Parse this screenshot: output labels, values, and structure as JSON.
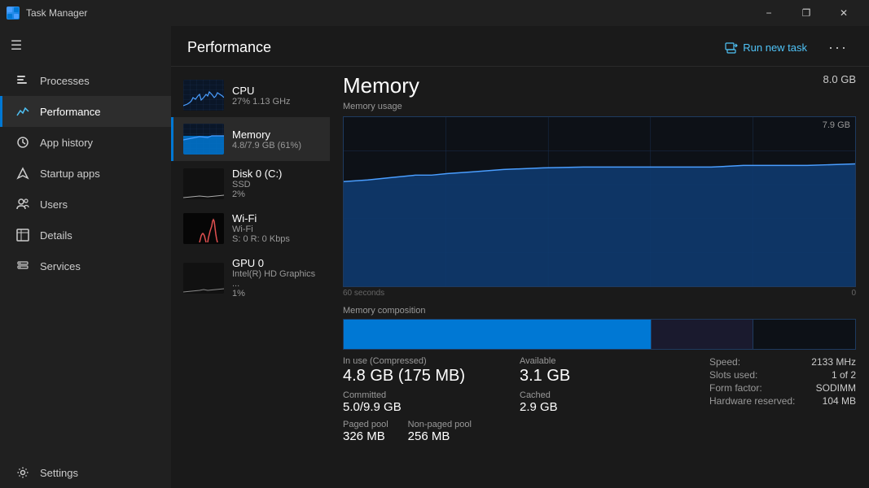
{
  "titlebar": {
    "icon_label": "task-manager-icon",
    "title": "Task Manager",
    "minimize_label": "−",
    "restore_label": "❐",
    "close_label": "✕"
  },
  "sidebar": {
    "menu_icon": "☰",
    "items": [
      {
        "id": "processes",
        "label": "Processes",
        "icon": "processes-icon"
      },
      {
        "id": "performance",
        "label": "Performance",
        "icon": "performance-icon",
        "active": true
      },
      {
        "id": "app-history",
        "label": "App history",
        "icon": "app-history-icon"
      },
      {
        "id": "startup-apps",
        "label": "Startup apps",
        "icon": "startup-icon"
      },
      {
        "id": "users",
        "label": "Users",
        "icon": "users-icon"
      },
      {
        "id": "details",
        "label": "Details",
        "icon": "details-icon"
      },
      {
        "id": "services",
        "label": "Services",
        "icon": "services-icon"
      }
    ],
    "settings": {
      "id": "settings",
      "label": "Settings",
      "icon": "settings-icon"
    }
  },
  "header": {
    "title": "Performance",
    "run_new_task_label": "Run new task",
    "more_label": "···"
  },
  "devices": [
    {
      "id": "cpu",
      "name": "CPU",
      "sub1": "27%  1.13 GHz",
      "active": false
    },
    {
      "id": "memory",
      "name": "Memory",
      "sub1": "4.8/7.9 GB (61%)",
      "active": true
    },
    {
      "id": "disk0",
      "name": "Disk 0 (C:)",
      "sub1": "SSD",
      "sub2": "2%",
      "active": false
    },
    {
      "id": "wifi",
      "name": "Wi-Fi",
      "sub1": "Wi-Fi",
      "sub2": "S: 0 R: 0 Kbps",
      "active": false
    },
    {
      "id": "gpu0",
      "name": "GPU 0",
      "sub1": "Intel(R) HD Graphics ...",
      "sub2": "1%",
      "active": false
    }
  ],
  "detail": {
    "title": "Memory",
    "total": "8.0 GB",
    "chart_label": "Memory usage",
    "chart_max": "7.9 GB",
    "chart_time_left": "60 seconds",
    "chart_time_right": "0",
    "composition_label": "Memory composition",
    "stats": {
      "in_use_label": "In use (Compressed)",
      "in_use_value": "4.8 GB (175 MB)",
      "available_label": "Available",
      "available_value": "3.1 GB",
      "committed_label": "Committed",
      "committed_value": "5.0/9.9 GB",
      "cached_label": "Cached",
      "cached_value": "2.9 GB",
      "paged_pool_label": "Paged pool",
      "paged_pool_value": "326 MB",
      "non_paged_pool_label": "Non-paged pool",
      "non_paged_pool_value": "256 MB",
      "speed_label": "Speed:",
      "speed_value": "2133 MHz",
      "slots_label": "Slots used:",
      "slots_value": "1 of 2",
      "form_factor_label": "Form factor:",
      "form_factor_value": "SODIMM",
      "hw_reserved_label": "Hardware reserved:",
      "hw_reserved_value": "104 MB"
    }
  },
  "colors": {
    "accent": "#0078d4",
    "sidebar_bg": "#202020",
    "content_bg": "#1a1a1a",
    "chart_bg": "#0d1117",
    "chart_border": "#1e3a5f",
    "text_primary": "#ffffff",
    "text_secondary": "#cccccc",
    "text_muted": "#999999",
    "active_border": "#0078d4",
    "chart_fill": "#0078d4"
  }
}
